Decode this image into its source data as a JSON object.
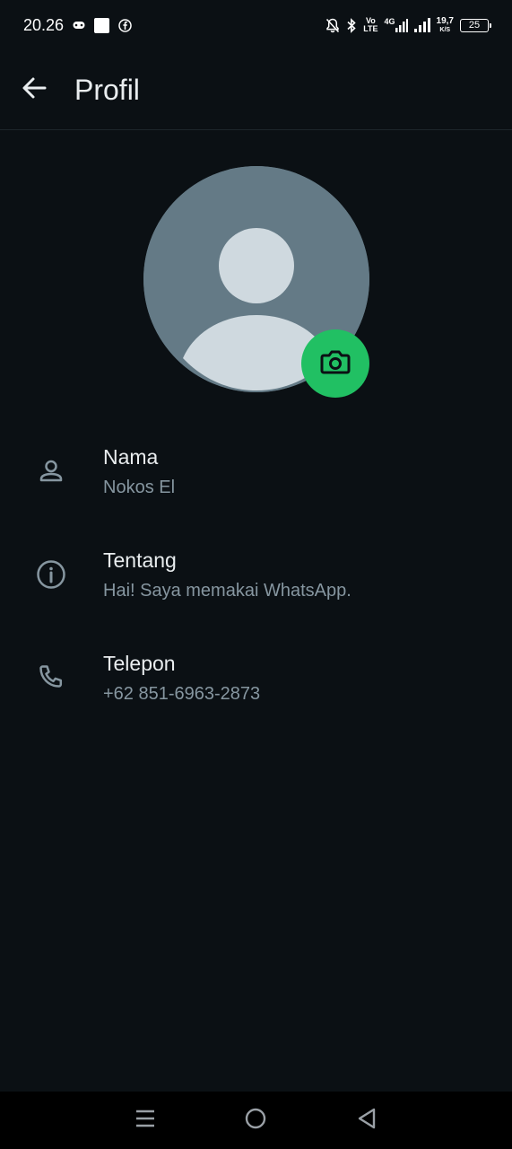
{
  "status_bar": {
    "time": "20.26",
    "volte_top": "Vo",
    "volte_bottom": "LTE",
    "net_type": "4G",
    "speed_value": "19,7",
    "speed_unit": "K/S",
    "battery": "25"
  },
  "header": {
    "title": "Profil"
  },
  "profile": {
    "fields": [
      {
        "icon": "person-icon",
        "label": "Nama",
        "value": "Nokos El"
      },
      {
        "icon": "info-icon",
        "label": "Tentang",
        "value": "Hai! Saya memakai WhatsApp."
      },
      {
        "icon": "phone-icon",
        "label": "Telepon",
        "value": "+62 851-6963-2873"
      }
    ]
  },
  "colors": {
    "background": "#0b1014",
    "accent": "#21c063",
    "avatar_bg": "#647a86",
    "avatar_fg": "#cfd9df",
    "primary_text": "#e9edef",
    "secondary_text": "#8696a0"
  }
}
